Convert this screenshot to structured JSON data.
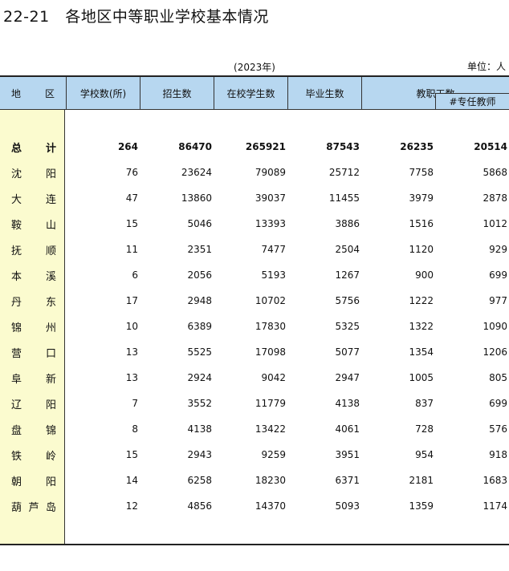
{
  "title": "22-21   各地区中等职业学校基本情况",
  "year": "(2023年)",
  "unit": "单位：人",
  "headers": {
    "region_a": "地",
    "region_b": "区",
    "schools": "学校数(所)",
    "enrollment": "招生数",
    "students": "在校学生数",
    "graduates": "毕业生数",
    "staff": "教职工数",
    "teachers": "#专任教师"
  },
  "rows": [
    {
      "name": [
        "总",
        "计"
      ],
      "values": [
        "264",
        "86470",
        "265921",
        "87543",
        "26235",
        "20514"
      ]
    },
    {
      "name": [
        "沈",
        "阳"
      ],
      "values": [
        "76",
        "23624",
        "79089",
        "25712",
        "7758",
        "5868"
      ]
    },
    {
      "name": [
        "大",
        "连"
      ],
      "values": [
        "47",
        "13860",
        "39037",
        "11455",
        "3979",
        "2878"
      ]
    },
    {
      "name": [
        "鞍",
        "山"
      ],
      "values": [
        "15",
        "5046",
        "13393",
        "3886",
        "1516",
        "1012"
      ]
    },
    {
      "name": [
        "抚",
        "顺"
      ],
      "values": [
        "11",
        "2351",
        "7477",
        "2504",
        "1120",
        "929"
      ]
    },
    {
      "name": [
        "本",
        "溪"
      ],
      "values": [
        "6",
        "2056",
        "5193",
        "1267",
        "900",
        "699"
      ]
    },
    {
      "name": [
        "丹",
        "东"
      ],
      "values": [
        "17",
        "2948",
        "10702",
        "5756",
        "1222",
        "977"
      ]
    },
    {
      "name": [
        "锦",
        "州"
      ],
      "values": [
        "10",
        "6389",
        "17830",
        "5325",
        "1322",
        "1090"
      ]
    },
    {
      "name": [
        "营",
        "口"
      ],
      "values": [
        "13",
        "5525",
        "17098",
        "5077",
        "1354",
        "1206"
      ]
    },
    {
      "name": [
        "阜",
        "新"
      ],
      "values": [
        "13",
        "2924",
        "9042",
        "2947",
        "1005",
        "805"
      ]
    },
    {
      "name": [
        "辽",
        "阳"
      ],
      "values": [
        "7",
        "3552",
        "11779",
        "4138",
        "837",
        "699"
      ]
    },
    {
      "name": [
        "盘",
        "锦"
      ],
      "values": [
        "8",
        "4138",
        "13422",
        "4061",
        "728",
        "576"
      ]
    },
    {
      "name": [
        "铁",
        "岭"
      ],
      "values": [
        "15",
        "2943",
        "9259",
        "3951",
        "954",
        "918"
      ]
    },
    {
      "name": [
        "朝",
        "阳"
      ],
      "values": [
        "14",
        "6258",
        "18230",
        "6371",
        "2181",
        "1683"
      ]
    },
    {
      "name": [
        "葫",
        "芦",
        "岛"
      ],
      "values": [
        "12",
        "4856",
        "14370",
        "5093",
        "1359",
        "1174"
      ]
    }
  ]
}
